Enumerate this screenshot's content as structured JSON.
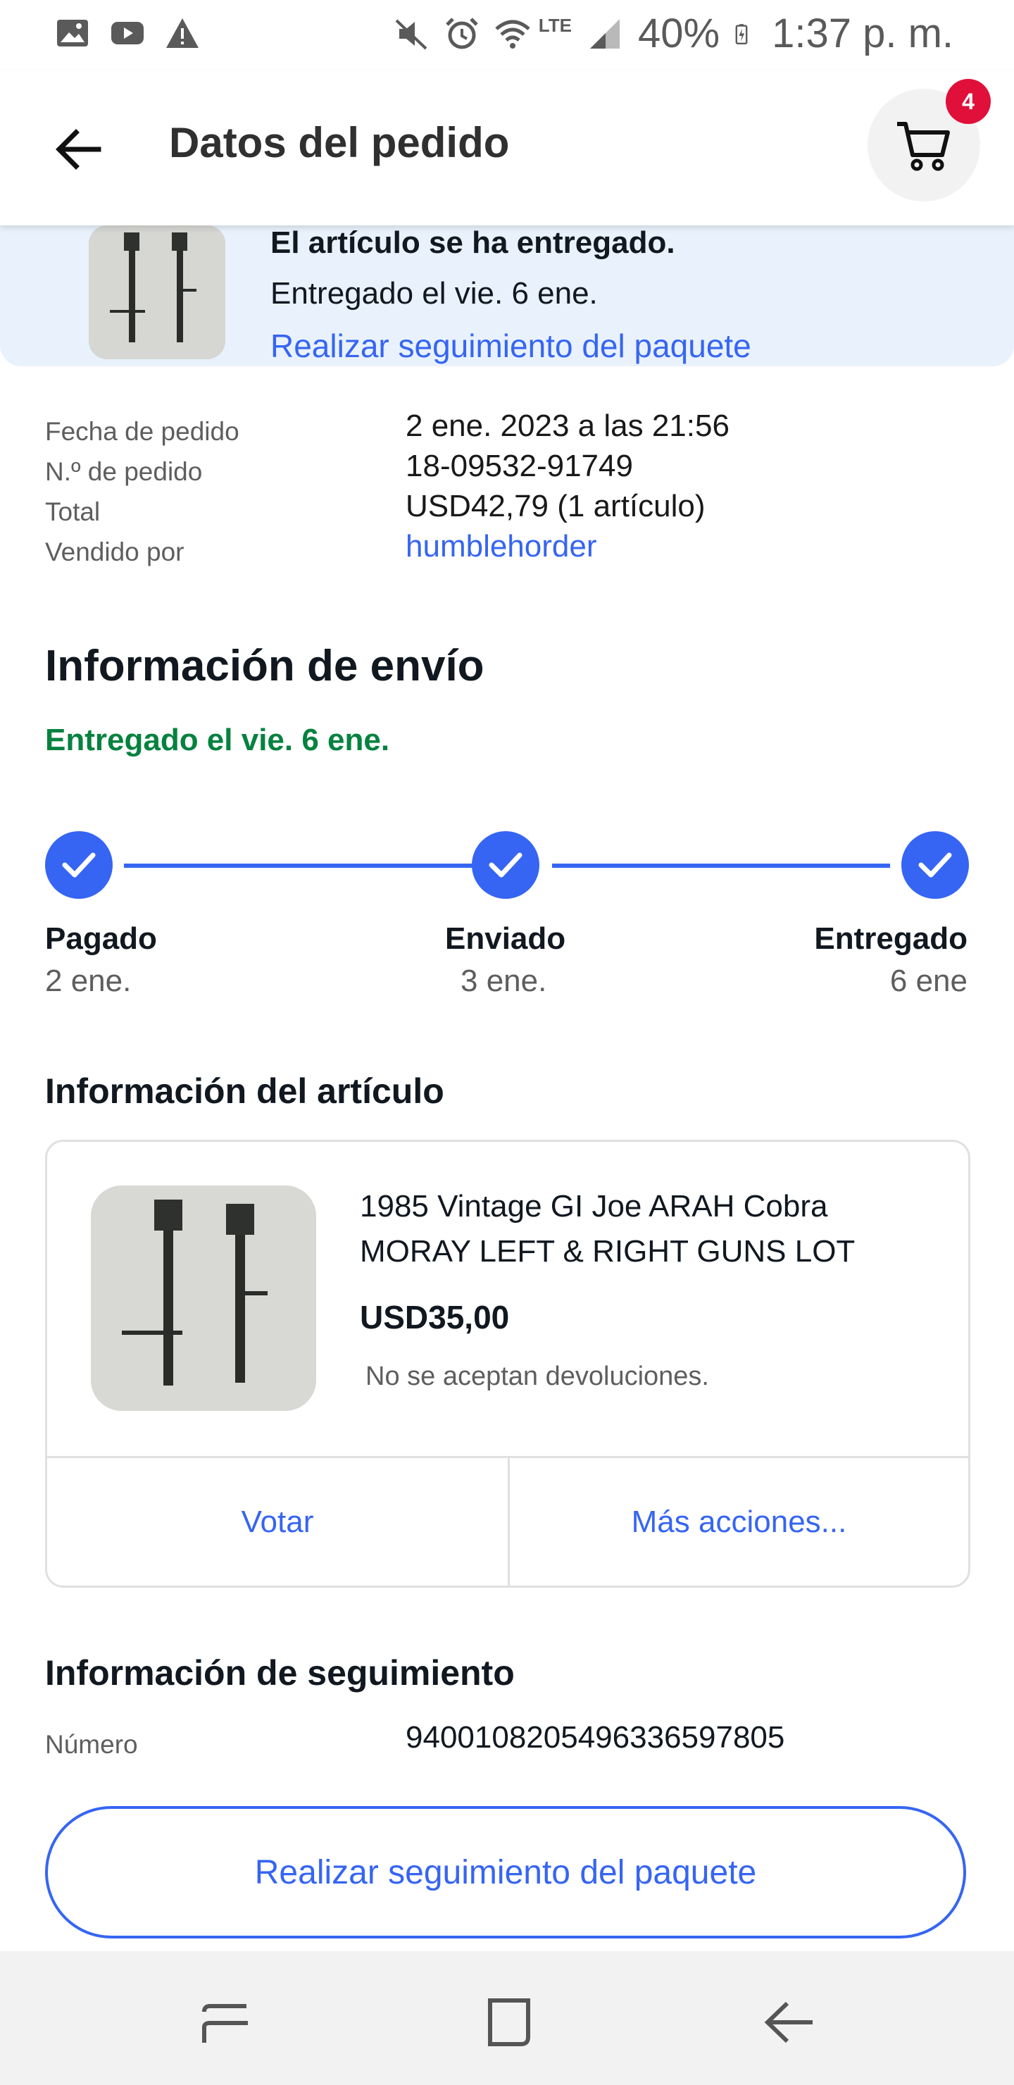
{
  "status_bar": {
    "battery": "40%",
    "time": "1:37 p. m.",
    "network": "LTE"
  },
  "header": {
    "title": "Datos del pedido",
    "cart_count": "4"
  },
  "banner": {
    "title": "El artículo se ha entregado.",
    "subtitle": "Entregado el vie. 6 ene.",
    "link": "Realizar seguimiento del paquete"
  },
  "order": {
    "rows": [
      {
        "label": "Fecha de pedido",
        "value": "2 ene. 2023 a las 21:56"
      },
      {
        "label": "N.º de pedido",
        "value": "18-09532-91749"
      },
      {
        "label": "Total",
        "value": "USD42,79 (1 artículo)"
      },
      {
        "label": "Vendido por",
        "value": "humblehorder"
      }
    ]
  },
  "shipping": {
    "heading": "Información de envío",
    "status": "Entregado el vie. 6 ene.",
    "stages": [
      {
        "name": "Pagado",
        "date": "2 ene."
      },
      {
        "name": "Enviado",
        "date": "3 ene."
      },
      {
        "name": "Entregado",
        "date": "6 ene"
      }
    ]
  },
  "item": {
    "heading": "Información del artículo",
    "title": "1985 Vintage GI Joe ARAH Cobra MORAY LEFT & RIGHT GUNS LOT",
    "price": "USD35,00",
    "returns": "No se aceptan devoluciones.",
    "vote_label": "Votar",
    "more_label": "Más acciones..."
  },
  "tracking": {
    "heading": "Información de seguimiento",
    "number_label": "Número",
    "number_value": "9400108205496336597805",
    "button": "Realizar seguimiento del paquete"
  },
  "colors": {
    "accent": "#3665f3",
    "success": "#05823f",
    "badge": "#e0103a",
    "banner_bg": "#e9f2fc"
  }
}
